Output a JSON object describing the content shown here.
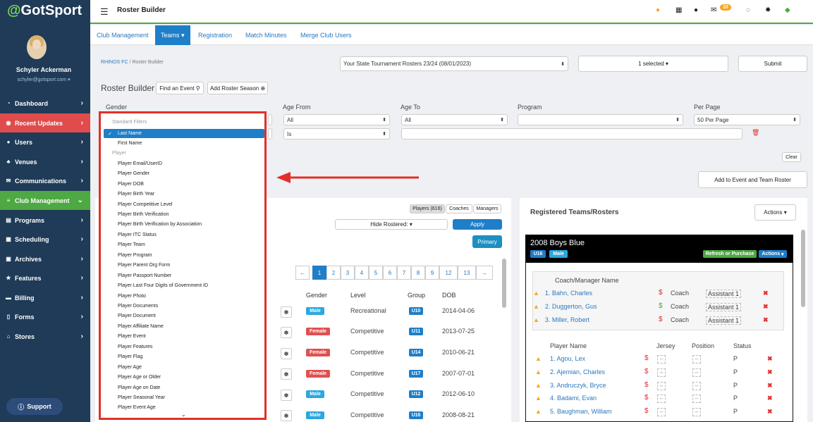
{
  "sidebar": {
    "logo": "GotSport",
    "user_name": "Schyler Ackerman",
    "user_email": "schyler@gotsport.com",
    "items": [
      {
        "label": "Dashboard",
        "icon": "dashboard-icon"
      },
      {
        "label": "Recent Updates",
        "icon": "updates-icon"
      },
      {
        "label": "Users",
        "icon": "users-icon"
      },
      {
        "label": "Venues",
        "icon": "venues-icon"
      },
      {
        "label": "Communications",
        "icon": "chat-icon"
      },
      {
        "label": "Club Management",
        "icon": "club-icon"
      },
      {
        "label": "Programs",
        "icon": "programs-icon"
      },
      {
        "label": "Scheduling",
        "icon": "calendar-icon"
      },
      {
        "label": "Archives",
        "icon": "archive-icon"
      },
      {
        "label": "Features",
        "icon": "star-icon"
      },
      {
        "label": "Billing",
        "icon": "billing-icon"
      },
      {
        "label": "Forms",
        "icon": "forms-icon"
      },
      {
        "label": "Stores",
        "icon": "store-icon"
      }
    ],
    "support": "Support"
  },
  "topbar": {
    "title": "Roster Builder",
    "notif_count": "10"
  },
  "subnav": [
    "Club Management",
    "Teams",
    "Registration",
    "Match Minutes",
    "Merge Club Users"
  ],
  "breadcrumb": {
    "club": "RHINOS FC",
    "sep": "/",
    "page": "Roster Builder"
  },
  "roster_select": "Your State Tournament Rosters 23/24 (08/01/2023)",
  "selected_label": "1 selected",
  "submit": "Submit",
  "builder_title": "Roster Builder",
  "find_event": "Find an Event",
  "add_roster_season": "Add Roster Season",
  "filters": {
    "gender": "Gender",
    "age_from": "Age From",
    "age_to": "Age To",
    "program": "Program",
    "per_page": "Per Page",
    "all": "All",
    "is": "Is",
    "per_page_value": "50 Per Page",
    "clear": "Clear"
  },
  "add_event_roster": "Add to Event and Team Roster",
  "tabs": {
    "players": "Players (616)",
    "coaches": "Coaches",
    "managers": "Managers"
  },
  "hide_rostered": "Hide Rostered:",
  "apply": "Apply",
  "primary": "Primary",
  "pages": [
    "←",
    "1",
    "2",
    "3",
    "4",
    "5",
    "6",
    "7",
    "8",
    "9",
    "12",
    "13",
    "→"
  ],
  "table": {
    "headers": [
      "Gender",
      "Level",
      "Group",
      "DOB"
    ],
    "rows": [
      {
        "gender": "Male",
        "level": "Recreational",
        "group": "U10",
        "dob": "2014-04-06"
      },
      {
        "gender": "Female",
        "level": "Competitive",
        "group": "U11",
        "dob": "2013-07-25"
      },
      {
        "gender": "Female",
        "level": "Competitive",
        "group": "U14",
        "dob": "2010-06-21"
      },
      {
        "gender": "Female",
        "level": "Competitive",
        "group": "U17",
        "dob": "2007-07-01"
      },
      {
        "gender": "Male",
        "level": "Competitive",
        "group": "U12",
        "dob": "2012-06-10"
      },
      {
        "gender": "Male",
        "level": "Competitive",
        "group": "U16",
        "dob": "2008-08-21"
      }
    ]
  },
  "dropdown": {
    "h1": "Standard Filters",
    "selected": "Last Name",
    "first_name": "First Name",
    "h2": "Player",
    "items": [
      "Player Email/UserID",
      "Player Gender",
      "Player DOB",
      "Player Birth Year",
      "Player Competitive Level",
      "Player Birth Verification",
      "Player Birth Verification by Association",
      "Player ITC Status",
      "Player Team",
      "Player Program",
      "Player Parent Org Form",
      "Player Passport Number",
      "Player Last Four Digits of Government ID",
      "Player Photo",
      "Player Documents",
      "Player Document",
      "Player Affiliate Name",
      "Player Event",
      "Player Features",
      "Player Flag",
      "Player Age",
      "Player Age or Older",
      "Player Age on Date",
      "Player Seasonal Year",
      "Player Event Age"
    ]
  },
  "right": {
    "title": "Registered Teams/Rosters",
    "actions": "Actions",
    "team_name": "2008 Boys Blue",
    "tags": [
      "U16",
      "Male"
    ],
    "refresh": "Refresh or Purchase",
    "team_actions": "Actions",
    "coach_header": "Coach/Manager Name",
    "coaches": [
      {
        "name": "1. Bahn, Charles",
        "role": "Coach",
        "assist": "Assistant 1"
      },
      {
        "name": "2. Duggerton, Gus",
        "role": "Coach",
        "assist": "Assistant 1"
      },
      {
        "name": "3. Miller, Robert",
        "role": "Coach",
        "assist": "Assistant 1"
      }
    ],
    "player_headers": [
      "Player Name",
      "Jersey",
      "Position",
      "Status"
    ],
    "players": [
      {
        "name": "1. Agou, Lex",
        "status": "P"
      },
      {
        "name": "2. Ajemian, Charles",
        "status": "P"
      },
      {
        "name": "3. Andruczyk, Bryce",
        "status": "P"
      },
      {
        "name": "4. Badami, Evan",
        "status": "P"
      },
      {
        "name": "5. Baughman, William",
        "status": "P"
      }
    ],
    "dash": "--"
  },
  "colors": {
    "sidebar": "#1f3b57",
    "accent": "#1e7ec8",
    "green": "#4ea843",
    "red": "#e04c4c",
    "highlight": "#e0302a"
  }
}
